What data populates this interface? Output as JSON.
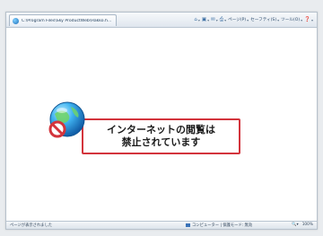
{
  "tab": {
    "title": "C:\\Program Files\\Sky ProductWeb\\Hakko.h...",
    "favicon": "ie-page-icon"
  },
  "command_bar": [
    {
      "name": "home-icon",
      "glyph": "⌂",
      "label": "",
      "dropdown": "▾"
    },
    {
      "name": "feeds-icon",
      "glyph": "▣",
      "label": "",
      "dropdown": "▾"
    },
    {
      "name": "mail-icon",
      "glyph": "✉",
      "label": "",
      "dropdown": "▾"
    },
    {
      "name": "print-icon",
      "glyph": "⎙",
      "label": "",
      "dropdown": "▾"
    },
    {
      "name": "page-menu",
      "glyph": "",
      "label": "ページ(P)",
      "dropdown": "▾"
    },
    {
      "name": "safety-menu",
      "glyph": "",
      "label": "セーフティ(S)",
      "dropdown": "▾"
    },
    {
      "name": "tools-menu",
      "glyph": "",
      "label": "ツール(O)",
      "dropdown": "▾"
    },
    {
      "name": "help-icon",
      "glyph": "❓",
      "label": "",
      "dropdown": "▾"
    }
  ],
  "message": {
    "line1": "インターネットの閲覧は",
    "line2": "禁止されています"
  },
  "status": {
    "left": "ページが表示されました",
    "zone": "コンピューター | 保護モード: 無効",
    "zoom": "100%"
  },
  "colors": {
    "accent_red": "#d3343c",
    "globe_blue": "#2a8fd8"
  }
}
